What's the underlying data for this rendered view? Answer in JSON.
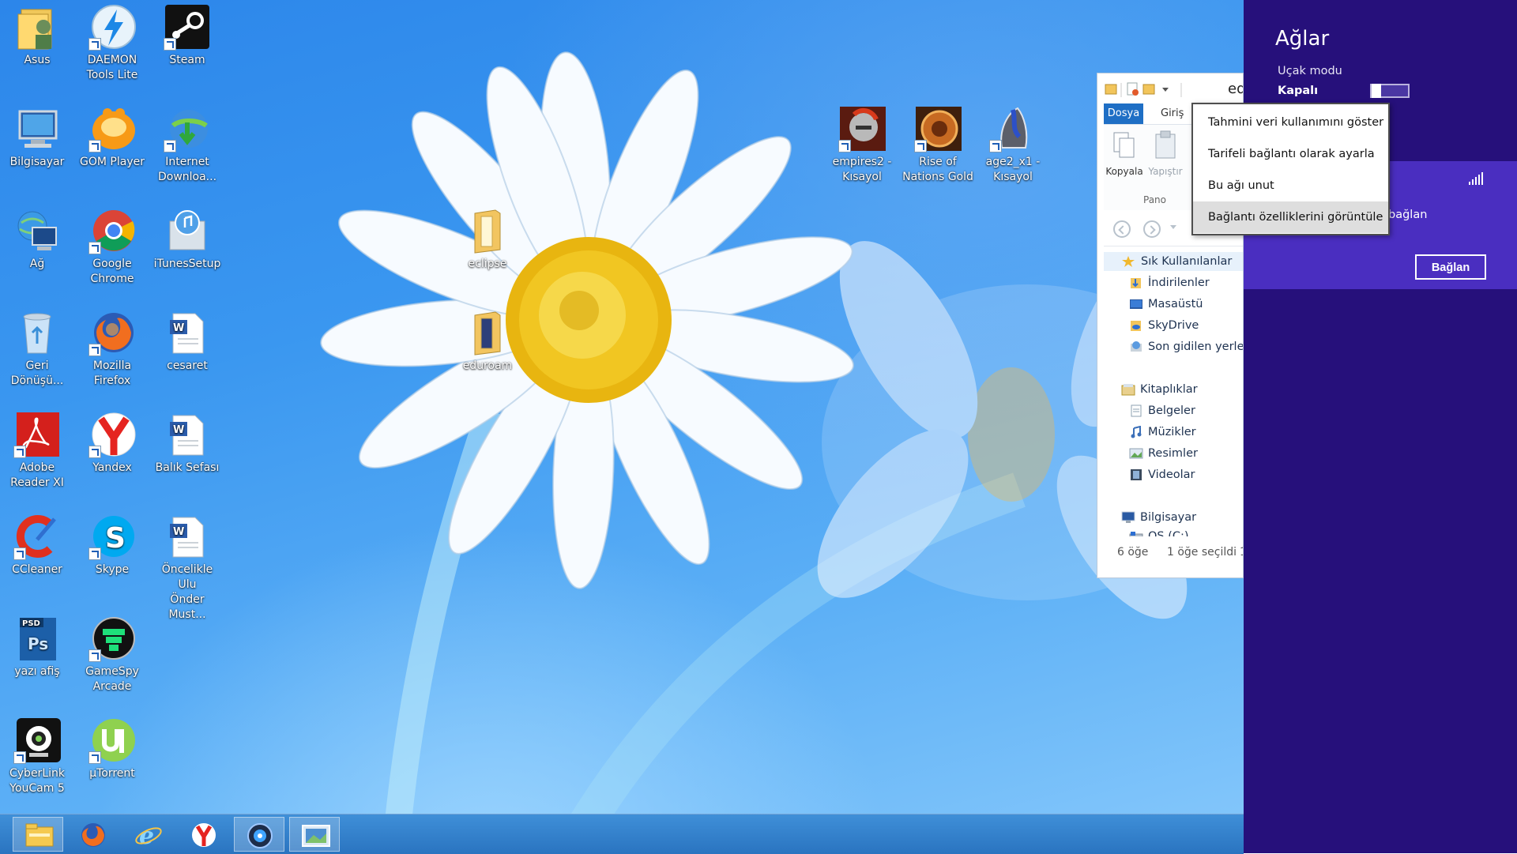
{
  "desktop": {
    "icons": [
      {
        "label": "Asus",
        "icon": "user-folder-icon"
      },
      {
        "label": "DAEMON\nTools Lite",
        "icon": "daemon-tools-icon"
      },
      {
        "label": "Steam",
        "icon": "steam-icon"
      },
      {
        "label": "Bilgisayar",
        "icon": "computer-icon"
      },
      {
        "label": "GOM Player",
        "icon": "gom-player-icon"
      },
      {
        "label": "Internet\nDownloa...",
        "icon": "internet-download-manager-icon"
      },
      {
        "label": "Ağ",
        "icon": "network-icon"
      },
      {
        "label": "Google\nChrome",
        "icon": "chrome-icon"
      },
      {
        "label": "iTunesSetup",
        "icon": "itunes-setup-icon"
      },
      {
        "label": "Geri\nDönüşü...",
        "icon": "recycle-bin-icon"
      },
      {
        "label": "Mozilla\nFirefox",
        "icon": "firefox-icon"
      },
      {
        "label": "cesaret",
        "icon": "word-document-icon"
      },
      {
        "label": "Adobe\nReader XI",
        "icon": "adobe-reader-icon"
      },
      {
        "label": "Yandex",
        "icon": "yandex-icon"
      },
      {
        "label": "Balık Sefası",
        "icon": "word-document-icon"
      },
      {
        "label": "CCleaner",
        "icon": "ccleaner-icon"
      },
      {
        "label": "Skype",
        "icon": "skype-icon"
      },
      {
        "label": "Öncelikle Ulu\nÖnder Must...",
        "icon": "word-document-icon"
      },
      {
        "label": "yazı afiş",
        "icon": "photoshop-psd-icon"
      },
      {
        "label": "GameSpy\nArcade",
        "icon": "gamespy-arcade-icon"
      },
      {
        "label": "CyberLink\nYouCam 5",
        "icon": "cyberlink-youcam-icon"
      },
      {
        "label": "µTorrent",
        "icon": "utorrent-icon"
      },
      {
        "label": "eclipse",
        "icon": "folder-icon"
      },
      {
        "label": "eduroam",
        "icon": "folder-icon"
      },
      {
        "label": "empires2 -\nKısayol",
        "icon": "age-of-empires-icon"
      },
      {
        "label": "Rise of\nNations Gold",
        "icon": "rise-of-nations-icon"
      },
      {
        "label": "age2_x1 -\nKısayol",
        "icon": "age2-conquerors-icon"
      }
    ]
  },
  "taskbar": {
    "items": [
      "file-explorer-icon",
      "firefox-icon",
      "internet-explorer-icon",
      "yandex-icon",
      "media-player-icon",
      "photo-viewer-icon"
    ]
  },
  "explorer": {
    "title": "ed",
    "tabs": {
      "file": "Dosya",
      "home": "Giriş"
    },
    "ribbon": {
      "copy": "Kopyala",
      "paste": "Yapıştır",
      "group": "Pano"
    },
    "tree": {
      "favorites": "Sık Kullanılanlar",
      "downloads": "İndirilenler",
      "desktop": "Masaüstü",
      "skydrive": "SkyDrive",
      "recent": "Son gidilen yerler",
      "libraries": "Kitaplıklar",
      "documents": "Belgeler",
      "music": "Müzikler",
      "pictures": "Resimler",
      "videos": "Videolar",
      "computer": "Bilgisayar",
      "os_drive": "OS (C:)"
    },
    "status": {
      "count": "6 öğe",
      "selected": "1 öğe seçildi",
      "extra": "1"
    }
  },
  "context_menu": {
    "items": [
      "Tahmini veri kullanımını göster",
      "Tarifeli bağlantı olarak ayarla",
      "Bu ağı unut",
      "Bağlantı özelliklerini görüntüle"
    ],
    "hovered_index": 3
  },
  "networks_charm": {
    "title": "Ağlar",
    "airplane_mode_label": "Uçak modu",
    "airplane_mode_state": "Kapalı",
    "airplane_mode_on": false,
    "connect_auto": "bağlan",
    "connect_button": "Bağlan",
    "accent_color": "#26107b",
    "panel_color": "#4a2ec0"
  }
}
